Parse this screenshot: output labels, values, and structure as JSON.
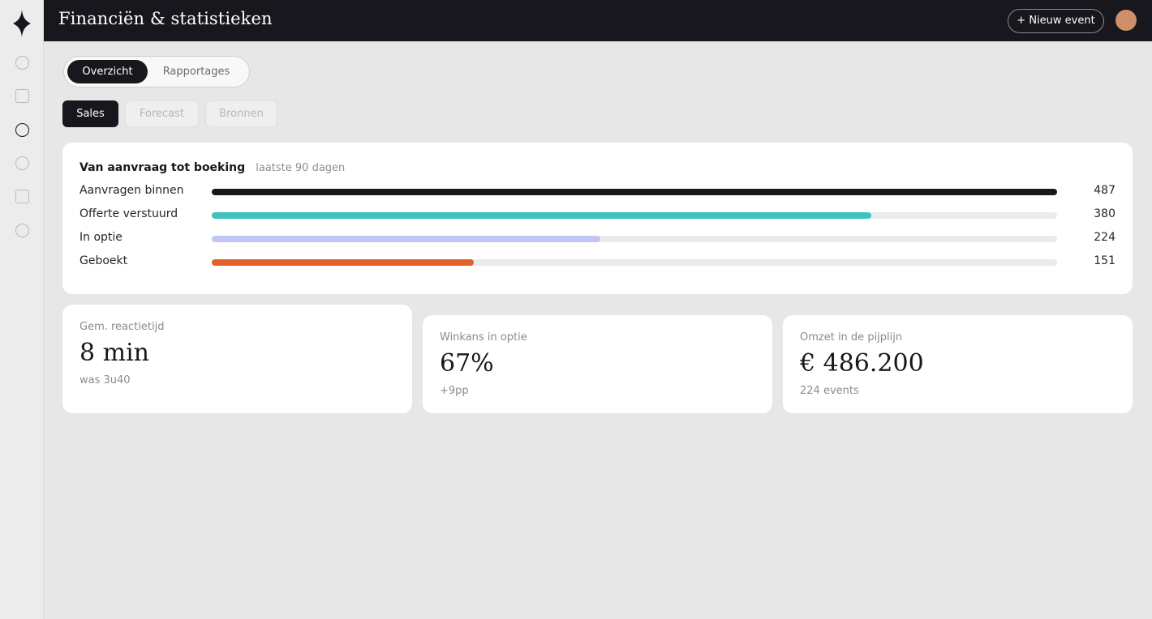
{
  "header": {
    "title": "Financiën & statistieken",
    "new_event_label": "+ Nieuw event"
  },
  "sidebar": {
    "items": [
      {
        "icon": "circle-icon"
      },
      {
        "icon": "square-icon"
      },
      {
        "icon": "circle-icon",
        "active": true
      },
      {
        "icon": "circle-icon"
      },
      {
        "icon": "square-icon"
      },
      {
        "icon": "circle-icon"
      }
    ]
  },
  "tabs": {
    "main": [
      {
        "label": "Overzicht",
        "active": true
      },
      {
        "label": "Rapportages",
        "active": false
      }
    ],
    "sub": [
      {
        "label": "Sales",
        "active": true
      },
      {
        "label": "Forecast",
        "active": false
      },
      {
        "label": "Bronnen",
        "active": false
      }
    ]
  },
  "funnel": {
    "title": "Van aanvraag tot boeking",
    "subtitle": "laatste 90 dagen",
    "max": 487,
    "rows": [
      {
        "label": "Aanvragen binnen",
        "value": 487,
        "display": "487",
        "color": "#18171d"
      },
      {
        "label": "Offerte verstuurd",
        "value": 380,
        "display": "380",
        "color": "#3cc3c0"
      },
      {
        "label": "In optie",
        "value": 224,
        "display": "224",
        "color": "#c2c6f4"
      },
      {
        "label": "Geboekt",
        "value": 151,
        "display": "151",
        "color": "#e0622a"
      }
    ]
  },
  "kpis": [
    {
      "label": "Gem. reactietijd",
      "value": "8 min",
      "note": "was 3u40"
    },
    {
      "label": "Winkans in optie",
      "value": "67%",
      "note": "+9pp"
    },
    {
      "label": "Omzet in de pijplijn",
      "value": "€ 486.200",
      "note": "224 events"
    }
  ],
  "colors": {
    "dark": "#18171d",
    "background": "#e7e7e7",
    "avatar": "#cf8f6a"
  }
}
